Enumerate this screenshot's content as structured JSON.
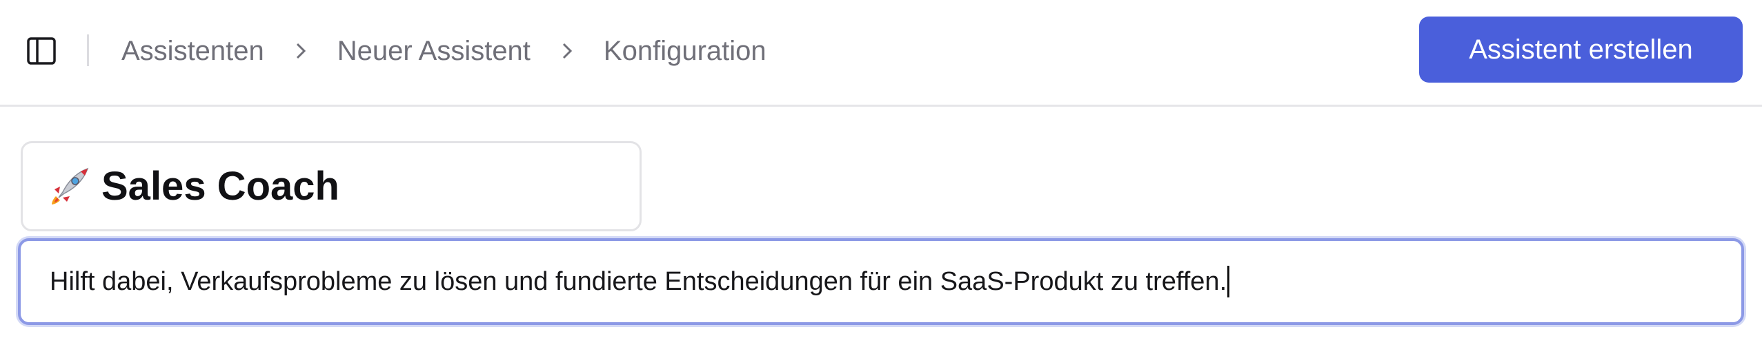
{
  "breadcrumb": {
    "items": [
      {
        "label": "Assistenten"
      },
      {
        "label": "Neuer Assistent"
      },
      {
        "label": "Konfiguration"
      }
    ]
  },
  "header": {
    "primary_button_label": "Assistent erstellen"
  },
  "assistant": {
    "emoji_icon": "rocket-icon",
    "name": "Sales Coach",
    "description": "Hilft dabei, Verkaufsprobleme zu lösen und fundierte Entscheidungen für ein SaaS-Produkt zu treffen."
  },
  "colors": {
    "primary": "#4a5fdb",
    "focus_border": "#8c99e6",
    "breadcrumb_text": "#6f6f78"
  }
}
